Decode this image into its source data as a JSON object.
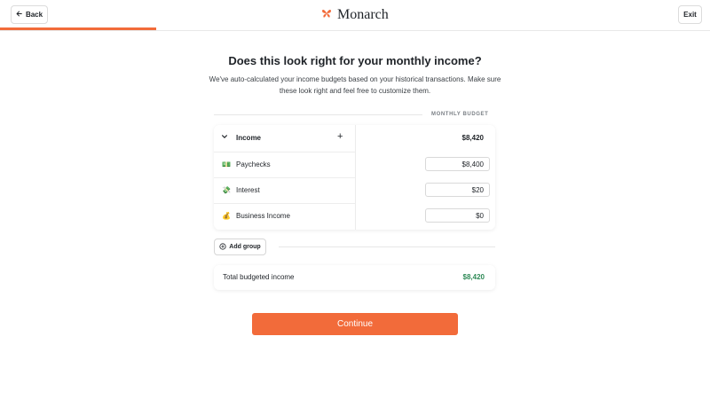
{
  "header": {
    "back_label": "Back",
    "exit_label": "Exit",
    "brand": "Monarch",
    "progress_fraction": 0.22,
    "accent_color": "#f26b3a"
  },
  "page": {
    "title": "Does this look right for your monthly income?",
    "subtitle": "We've auto-calculated your income budgets based on your historical transactions. Make sure these look right and feel free to customize them."
  },
  "budget": {
    "column_header": "MONTHLY BUDGET",
    "group": {
      "label": "Income",
      "amount": "$8,420"
    },
    "items": [
      {
        "emoji": "💵",
        "label": "Paychecks",
        "amount": "$8,400"
      },
      {
        "emoji": "💸",
        "label": "Interest",
        "amount": "$20"
      },
      {
        "emoji": "💰",
        "label": "Business Income",
        "amount": "$0"
      }
    ]
  },
  "actions": {
    "add_group_label": "Add group",
    "continue_label": "Continue"
  },
  "total": {
    "label": "Total budgeted income",
    "amount": "$8,420",
    "color": "#2f8a57"
  }
}
